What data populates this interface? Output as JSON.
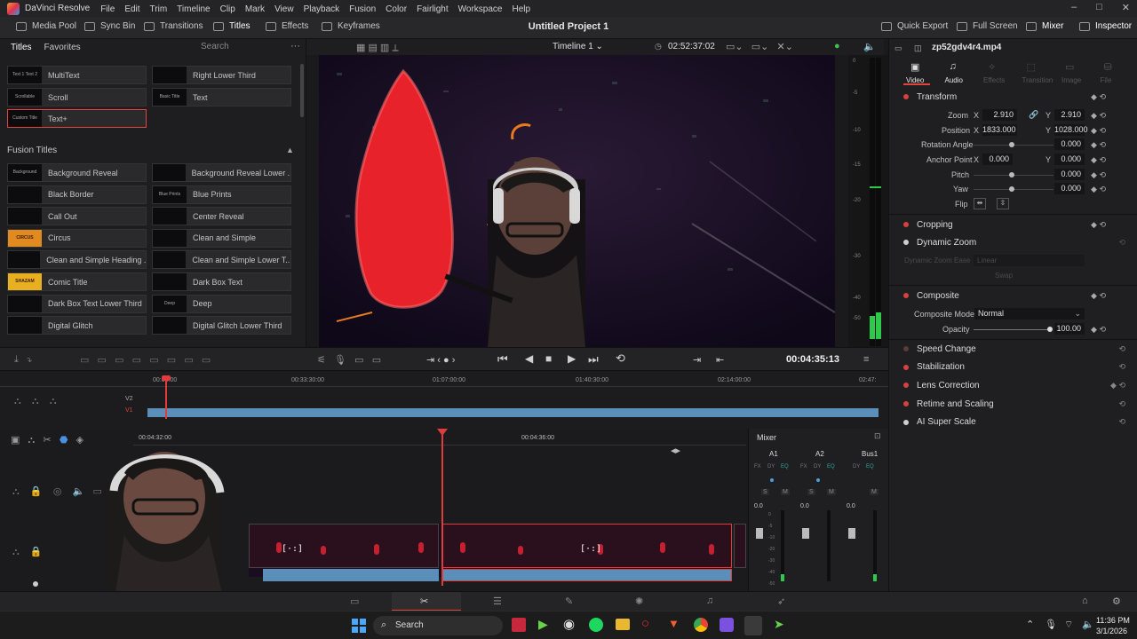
{
  "app": {
    "name": "DaVinci Resolve",
    "menu": [
      "File",
      "Edit",
      "Trim",
      "Timeline",
      "Clip",
      "Mark",
      "View",
      "Playback",
      "Fusion",
      "Color",
      "Fairlight",
      "Workspace",
      "Help"
    ]
  },
  "toolbar": {
    "left": [
      "Media Pool",
      "Sync Bin",
      "Transitions",
      "Titles",
      "Effects",
      "Keyframes"
    ],
    "project_title": "Untitled Project 1",
    "right": [
      "Quick Export",
      "Full Screen",
      "Mixer",
      "Inspector"
    ]
  },
  "effects_panel": {
    "tabs": [
      "Titles",
      "Favorites"
    ],
    "search_placeholder": "Search",
    "titles": [
      {
        "label": "MultiText",
        "thumb": "Text 1 Text 2"
      },
      {
        "label": "Right Lower Third",
        "thumb": ""
      },
      {
        "label": "Scroll",
        "thumb": "Scrollable"
      },
      {
        "label": "Text",
        "thumb": "Basic Title"
      },
      {
        "label": "Text+",
        "thumb": "Custom Title"
      }
    ],
    "fusion_section": "Fusion Titles",
    "fusion_titles": [
      {
        "label": "Background Reveal",
        "thumb": "Background Reveal"
      },
      {
        "label": "Background Reveal Lower ...",
        "thumb": ""
      },
      {
        "label": "Black Border",
        "thumb": ""
      },
      {
        "label": "Blue Prints",
        "thumb": "Blue Prints"
      },
      {
        "label": "Call Out",
        "thumb": ""
      },
      {
        "label": "Center Reveal",
        "thumb": ""
      },
      {
        "label": "Circus",
        "thumb": "CIRCUS"
      },
      {
        "label": "Clean and Simple",
        "thumb": ""
      },
      {
        "label": "Clean and Simple Heading ...",
        "thumb": ""
      },
      {
        "label": "Clean and Simple Lower T...",
        "thumb": ""
      },
      {
        "label": "Comic Title",
        "thumb": "SHAZAM"
      },
      {
        "label": "Dark Box Text",
        "thumb": ""
      },
      {
        "label": "Dark Box Text Lower Third",
        "thumb": ""
      },
      {
        "label": "Deep",
        "thumb": "Deep"
      },
      {
        "label": "Digital Glitch",
        "thumb": ""
      },
      {
        "label": "Digital Glitch Lower Third",
        "thumb": ""
      }
    ]
  },
  "viewer": {
    "timeline_name": "Timeline 1",
    "timecode_top": "02:52:37:02",
    "timecode_main": "00:04:35:13",
    "meter_labels": [
      "0",
      "-5",
      "-10",
      "-15",
      "-20",
      "-30",
      "-40",
      "-50"
    ]
  },
  "mini_timeline": {
    "ruler": [
      "00:00:00",
      "00:33:30:00",
      "01:07:00:00",
      "01:40:30:00",
      "02:14:00:00",
      "02:47:"
    ],
    "tracks": [
      "V2",
      "V1"
    ]
  },
  "main_timeline": {
    "ruler": [
      "00:04:32:00",
      "00:04:36:00"
    ]
  },
  "mixer": {
    "title": "Mixer",
    "channels": [
      "A1",
      "A2",
      "Bus1"
    ],
    "fx": [
      "FX",
      "DY",
      "EQ"
    ],
    "levels": [
      "0.0",
      "0.0",
      "0.0"
    ],
    "scale": [
      "0",
      "-5",
      "-10",
      "-20",
      "-30",
      "-40",
      "-50"
    ],
    "solo": "S",
    "mute": "M"
  },
  "inspector": {
    "clip_name": "zp52gdv4r4.mp4",
    "tabs": [
      "Video",
      "Audio",
      "Effects",
      "Transition",
      "Image",
      "File"
    ],
    "transform": {
      "title": "Transform",
      "zoom_label": "Zoom",
      "zoom_x": "2.910",
      "zoom_y": "2.910",
      "position_label": "Position",
      "position_x": "1833.000",
      "position_y": "1028.000",
      "rotation_label": "Rotation Angle",
      "rotation": "0.000",
      "anchor_label": "Anchor Point",
      "anchor_x": "0.000",
      "anchor_y": "0.000",
      "pitch_label": "Pitch",
      "pitch": "0.000",
      "yaw_label": "Yaw",
      "yaw": "0.000",
      "flip_label": "Flip",
      "x": "X",
      "y": "Y"
    },
    "cropping": "Cropping",
    "dynamic_zoom": "Dynamic Zoom",
    "dynamic_zoom_ease_label": "Dynamic Zoom Ease",
    "dynamic_zoom_ease_value": "Linear",
    "swap": "Swap",
    "composite": {
      "title": "Composite",
      "mode_label": "Composite Mode",
      "mode": "Normal",
      "opacity_label": "Opacity",
      "opacity": "100.00"
    },
    "sections": [
      "Speed Change",
      "Stabilization",
      "Lens Correction",
      "Retime and Scaling",
      "AI Super Scale"
    ]
  },
  "taskbar": {
    "search": "Search",
    "time": "11:36 PM",
    "date": "3/1/2026"
  },
  "colors": {
    "accent_red": "#e0443a",
    "clip_blue": "#5b8fb9",
    "playhead": "#e03c3c",
    "meter_green": "#2ec84a",
    "eq_teal": "#2aa7a0"
  }
}
